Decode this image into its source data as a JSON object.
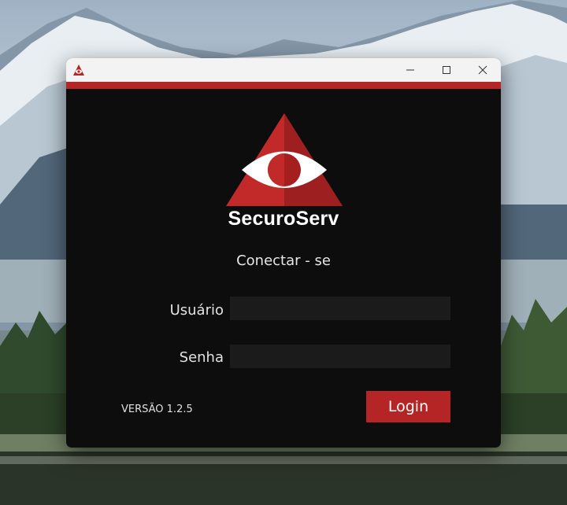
{
  "window": {
    "app_icon": "securoserv-icon",
    "controls": {
      "minimize": "minimize-icon",
      "maximize": "maximize-icon",
      "close": "close-icon"
    }
  },
  "brand": {
    "name": "SecuroServ",
    "logo": "securoserv-eye-triangle-logo"
  },
  "login": {
    "heading": "Conectar - se",
    "username_label": "Usuário",
    "username_value": "",
    "password_label": "Senha",
    "password_value": "",
    "button_label": "Login"
  },
  "footer": {
    "version": "VERSÃO 1.2.5"
  },
  "colors": {
    "accent": "#b52525",
    "window_bg": "#0d0d0d",
    "input_bg": "#1b1b1b",
    "titlebar_bg": "#f3f3f3"
  }
}
